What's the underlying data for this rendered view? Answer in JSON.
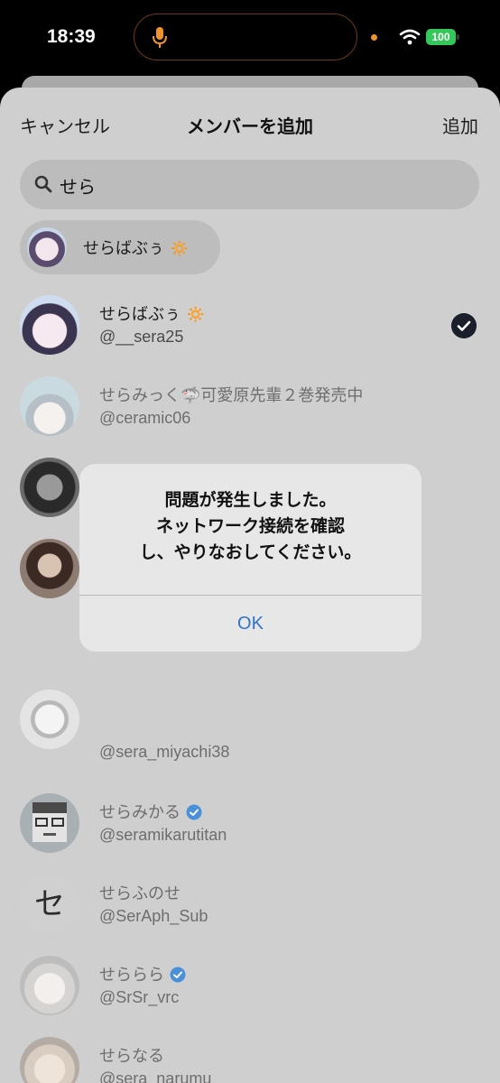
{
  "status_bar": {
    "time": "18:39",
    "battery": "100"
  },
  "header": {
    "cancel": "キャンセル",
    "title": "メンバーを追加",
    "add": "追加"
  },
  "search": {
    "query": "せら"
  },
  "selected_chip": {
    "label": "せらばぶぅ 🔅"
  },
  "users": [
    {
      "name": "せらばぶぅ 🔅",
      "handle": "@__sera25",
      "selected": true
    },
    {
      "name": "せらみっく🦈可愛原先輩２巻発売中",
      "handle": "@ceramic06"
    },
    {
      "name": "",
      "handle": ""
    },
    {
      "name": "",
      "handle": ""
    },
    {
      "name": "",
      "handle": "@sera_miyachi38"
    },
    {
      "name": "せらみかる",
      "handle": "@seramikarutitan",
      "verified": true
    },
    {
      "name": "せらふのせ",
      "handle": "@SerAph_Sub",
      "avatar_glyph": "セ"
    },
    {
      "name": "せららら",
      "handle": "@SrSr_vrc",
      "verified": true
    },
    {
      "name": "せらなる",
      "handle": "@sera_narumu"
    }
  ],
  "alert": {
    "line1": "問題が発生しました。",
    "line2": "ネットワーク接続を確認",
    "line3": "し、やりなおしてください。",
    "ok": "OK"
  },
  "colors": {
    "accent": "#2f74c9",
    "verified": "#4a90d9",
    "battery": "#34c759"
  }
}
